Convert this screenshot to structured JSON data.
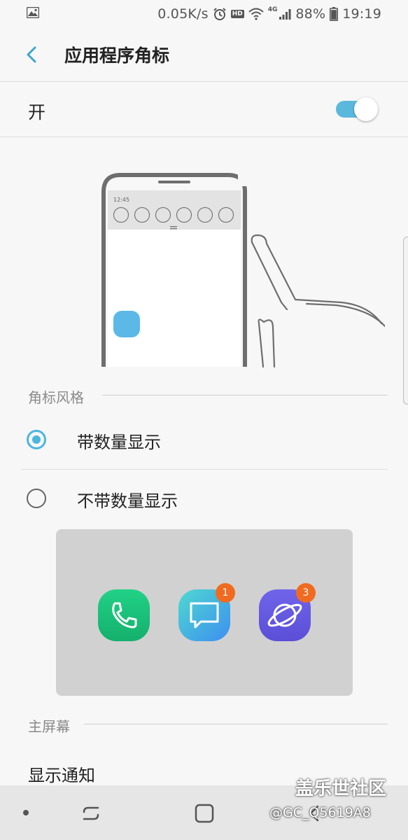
{
  "status_bar": {
    "network_speed": "0.05K/s",
    "hd_label": "HD",
    "network_type": "4G",
    "battery": "88%",
    "time": "19:19"
  },
  "header": {
    "title": "应用程序角标"
  },
  "master_switch": {
    "label": "开",
    "state": "on"
  },
  "illustration": {
    "phone_time": "12:45"
  },
  "badge_style_section": {
    "title": "角标风格",
    "options": [
      {
        "label": "带数量显示",
        "selected": true
      },
      {
        "label": "不带数量显示",
        "selected": false
      }
    ]
  },
  "preview": {
    "apps": [
      {
        "icon": "phone-icon",
        "badge": ""
      },
      {
        "icon": "message-icon",
        "badge": "1"
      },
      {
        "icon": "internet-icon",
        "badge": "3"
      }
    ]
  },
  "home_screen_section": {
    "title": "主屏幕",
    "items": [
      {
        "label": "显示通知"
      }
    ]
  },
  "watermark": {
    "line1": "盖乐世社区",
    "line2": "@GC_Q5619A8"
  },
  "colors": {
    "accent": "#4cb6df",
    "badge": "#f06b1f",
    "phone_app": "#1bc47d",
    "message_app": "#4aa8e8",
    "internet_app": "#6a5ee0"
  }
}
